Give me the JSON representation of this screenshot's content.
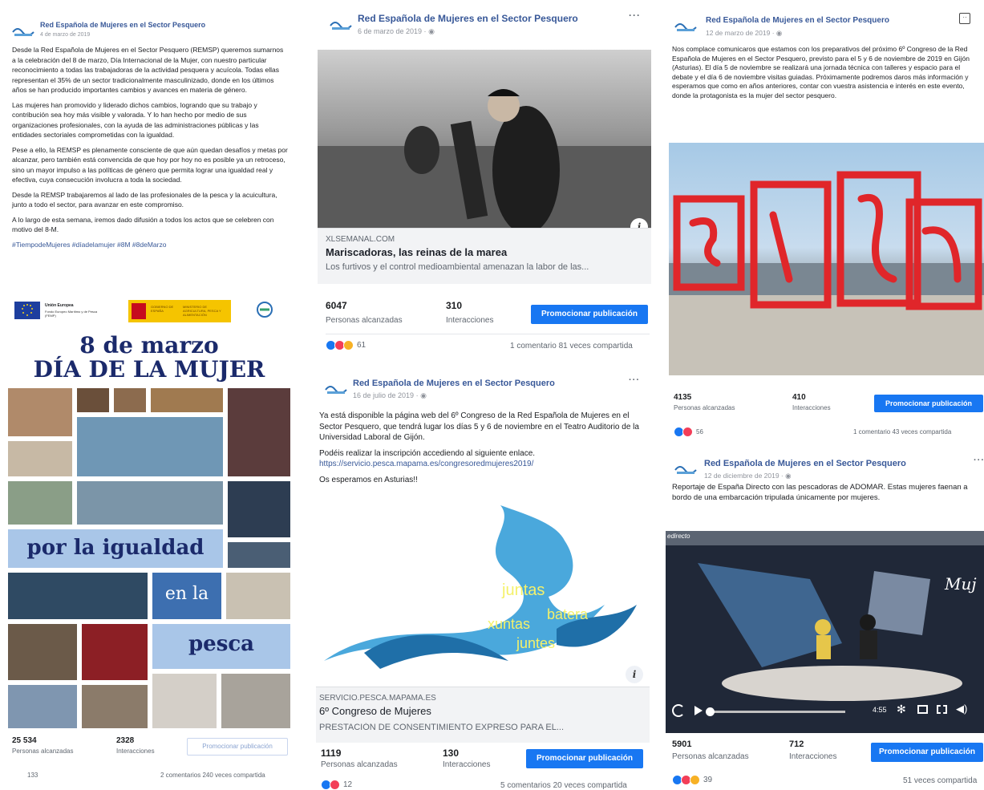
{
  "post1": {
    "page_name": "Red Española de Mujeres en el Sector Pesquero",
    "date": "4 de marzo de 2019",
    "paragraphs": [
      "Desde la Red Española de Mujeres en el Sector Pesquero (REMSP) queremos sumarnos a la celebración del 8 de marzo, Día Internacional de la Mujer, con nuestro particular reconocimiento a todas las trabajadoras de la actividad pesquera y acuícola. Todas ellas representan el 35% de un sector tradicionalmente masculinizado, donde en los últimos años se han producido importantes cambios y avances en materia de género.",
      "Las mujeres han promovido y liderado dichos cambios, logrando que su trabajo y contribución sea hoy más visible y valorada. Y lo han hecho por medio de sus organizaciones profesionales, con la ayuda de las administraciones públicas y las entidades sectoriales comprometidas con la igualdad.",
      "Pese a ello, la REMSP es plenamente consciente de que aún quedan desafíos y metas por alcanzar, pero también está convencida de que hoy por hoy no es posible ya un retroceso, sino un mayor impulso a las políticas de género que permita lograr una igualdad real y efectiva, cuya consecución involucra a toda la sociedad.",
      "Desde la REMSP trabajaremos al lado de las profesionales de la pesca y la acuicultura, junto a todo el sector, para avanzar en este compromiso.",
      "A lo largo de esta semana, iremos dado difusión a todos los actos que se celebren con motivo del 8-M."
    ],
    "hashtags": "#TiempodeMujeres #díadelamujer #8M #8deMarzo",
    "poster": {
      "eu_label": "Unión Europea",
      "eu_sub": "Fondo Europeo Marítimo y de Pesca (FEMP)",
      "gov_label": "GOBIERNO DE ESPAÑA",
      "ministry": "MINISTERIO DE AGRICULTURA, PESCA Y ALIMENTACIÓN",
      "title_line1": "8 de marzo",
      "title_line2": "DÍA DE LA MUJER",
      "slogan1": "por la igualdad",
      "slogan2": "en la",
      "slogan3": "pesca"
    },
    "reach": "25 534",
    "reach_label": "Personas alcanzadas",
    "interactions": "2328",
    "interactions_label": "Interacciones",
    "promote_label": "Promocionar publicación",
    "reaction_count": "133",
    "meta": "2 comentarios  240 veces compartida"
  },
  "post2": {
    "page_name": "Red Española de Mujeres en el Sector Pesquero",
    "date": "6 de marzo de 2019 · ",
    "link_domain": "XLSEMANAL.COM",
    "link_title": "Mariscadoras, las reinas de la marea",
    "link_desc": "Los furtivos y el control medioambiental amenazan la labor de las...",
    "reach": "6047",
    "reach_label": "Personas alcanzadas",
    "interactions": "310",
    "interactions_label": "Interacciones",
    "promote_label": "Promocionar publicación",
    "reaction_count": "61",
    "meta": "1 comentario  81 veces compartida"
  },
  "post3": {
    "page_name": "Red Española de Mujeres en el Sector Pesquero",
    "date": "16 de julio de 2019 · ",
    "paragraphs": [
      "Ya está disponible la página web del 6º Congreso de la Red Española de Mujeres en el Sector Pesquero, que tendrá lugar los días 5 y 6 de noviembre en el Teatro Auditorio de la Universidad Laboral de Gijón.",
      "Podéis realizar la inscripción accediendo al siguiente enlace."
    ],
    "url": "https://servicio.pesca.mapama.es/congresoredmujeres2019/",
    "closing": "Os esperamos en Asturias!!",
    "art_words": [
      "juntas",
      "batera",
      "xuntas",
      "juntes"
    ],
    "link_domain": "SERVICIO.PESCA.MAPAMA.ES",
    "link_title": "6º Congreso de Mujeres",
    "link_desc": "PRESTACIÓN DE CONSENTIMIENTO EXPRESO PARA EL...",
    "reach": "1119",
    "reach_label": "Personas alcanzadas",
    "interactions": "130",
    "interactions_label": "Interacciones",
    "promote_label": "Promocionar publicación",
    "reaction_count": "12",
    "meta": "5 comentarios  20 veces compartida"
  },
  "post4": {
    "page_name": "Red Española de Mujeres en el Sector Pesquero",
    "date": "12 de marzo de 2019 · ",
    "text": "Nos complace comunicaros que estamos con los preparativos del próximo 6º Congreso de la Red Española de Mujeres en el Sector Pesquero, previsto para el 5 y 6 de noviembre de 2019 en Gijón (Asturias). El día 5 de noviembre se realizará una jornada técnica con talleres y espacio para el debate y el día 6 de noviembre visitas guiadas. Próximamente podremos daros más información y esperamos que como en años anteriores, contar con vuestra asistencia e interés en este evento, donde la protagonista es la mujer del sector pesquero.",
    "reach": "4135",
    "reach_label": "Personas alcanzadas",
    "interactions": "410",
    "interactions_label": "Interacciones",
    "promote_label": "Promocionar publicación",
    "reaction_count": "56",
    "meta": "1 comentario  43 veces compartida"
  },
  "post5": {
    "page_name": "Red Española de Mujeres en el Sector Pesquero",
    "date": "12 de diciembre de 2019 · ",
    "text": "Reportaje de España Directo con las pescadoras de ADOMAR. Estas mujeres faenan a bordo de una embarcación tripulada únicamente por mujeres.",
    "video_channel": "edirecto",
    "video_overlay": "Muj",
    "video_time": "4:55",
    "reach": "5901",
    "reach_label": "Personas alcanzadas",
    "interactions": "712",
    "interactions_label": "Interacciones",
    "promote_label": "Promocionar publicación",
    "reaction_count": "39",
    "meta": "51 veces compartida"
  },
  "colors": {
    "link_blue": "#385898",
    "button_blue": "#1877f2",
    "poster_navy": "#1b2a6b",
    "poster_light": "#a9c6e8",
    "gijon_red": "#e0262a"
  }
}
